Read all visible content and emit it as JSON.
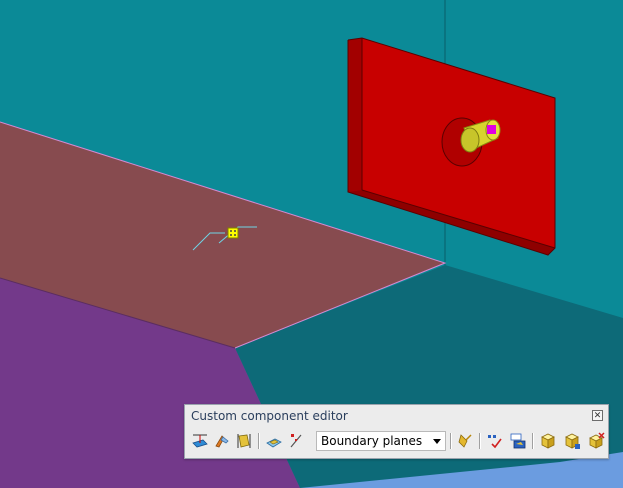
{
  "viewport": {
    "background_color": "#0b8a97",
    "floor_plane_color": "#874b4f",
    "purple_face_color": "#73398a",
    "dark_teal_face_color": "#0d6a78",
    "plate_color": "#c40000",
    "cylinder_color": "#d7d52e",
    "handle_color": "#e000e0"
  },
  "toolbar": {
    "title": "Custom component editor",
    "close_icon": "close-icon",
    "buttons_left": [
      {
        "name": "define-plane-button",
        "icon": "plane-define-icon"
      },
      {
        "name": "fitting-button",
        "icon": "fitting-icon"
      },
      {
        "name": "part-properties-button",
        "icon": "part-properties-icon"
      }
    ],
    "buttons_mid": [
      {
        "name": "boundary-plane-button",
        "icon": "boundary-plane-icon"
      },
      {
        "name": "pick-plane-button",
        "icon": "pick-plane-icon"
      }
    ],
    "select": {
      "value": "Boundary planes"
    },
    "buttons_right": [
      {
        "name": "magic-bind-button",
        "icon": "magic-bind-icon"
      },
      {
        "name": "check-button",
        "icon": "check-icon"
      },
      {
        "name": "variables-button",
        "icon": "variables-icon"
      },
      {
        "name": "save-component-button",
        "icon": "save-component-icon"
      },
      {
        "name": "save-as-component-button",
        "icon": "save-as-component-icon"
      },
      {
        "name": "close-editor-button",
        "icon": "close-editor-icon"
      }
    ]
  }
}
